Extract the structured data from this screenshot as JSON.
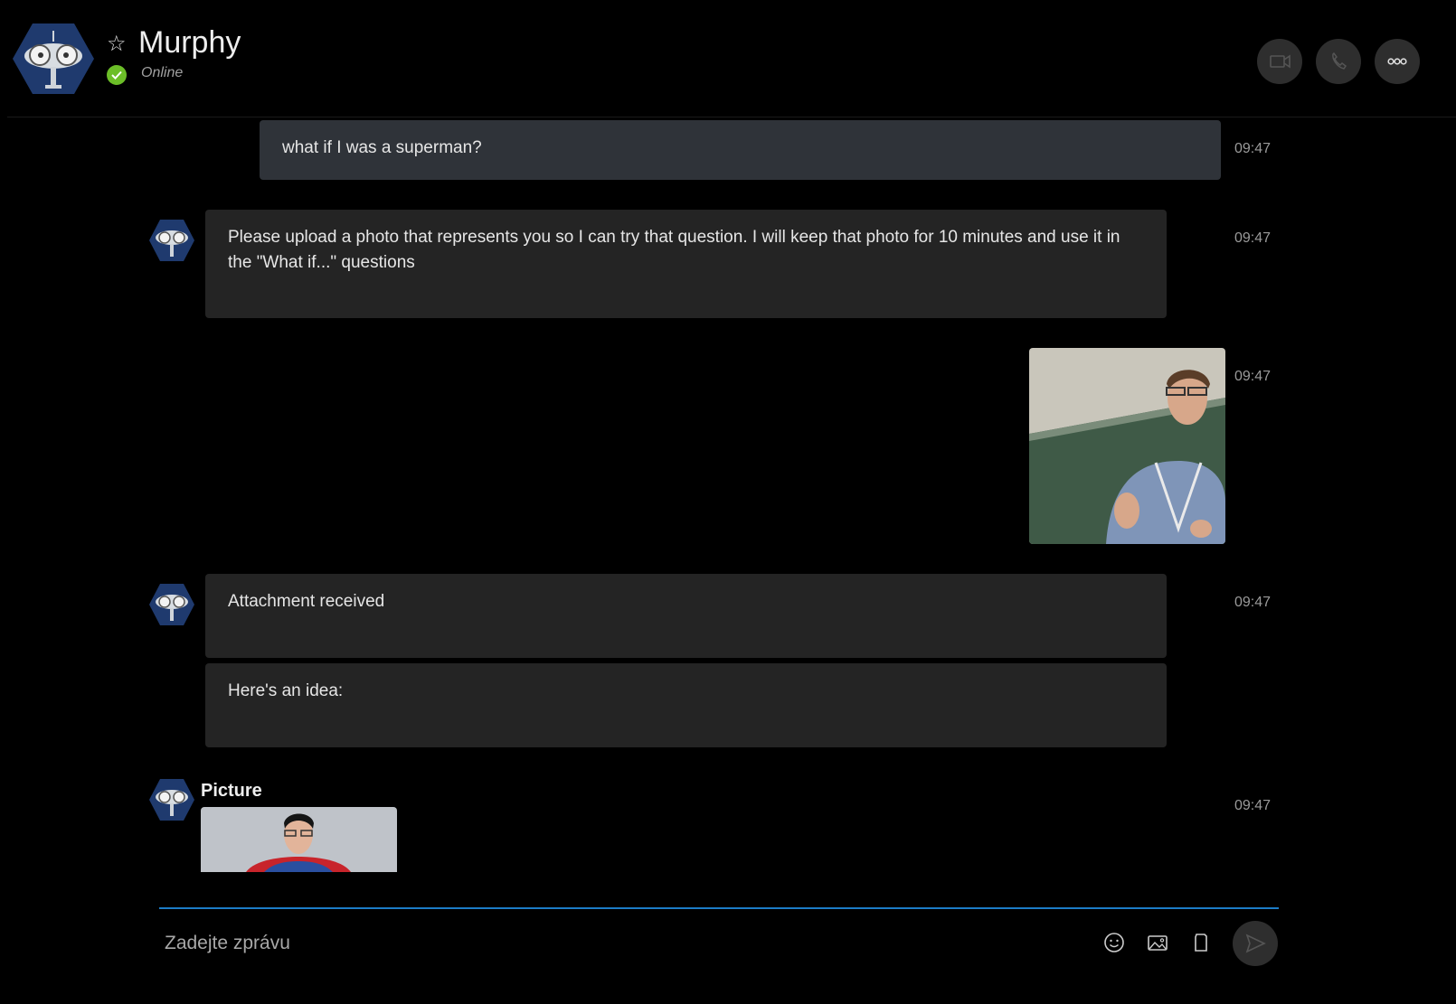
{
  "header": {
    "contact_name": "Murphy",
    "status": "Online",
    "status_color": "#6cbe28",
    "icons": [
      "star-icon",
      "video-call-icon",
      "phone-icon",
      "more-icon"
    ]
  },
  "messages": [
    {
      "direction": "outgoing",
      "type": "text",
      "text": "what if I was a superman?",
      "time": "09:47"
    },
    {
      "direction": "incoming",
      "type": "text",
      "text": "Please upload a photo that represents you so I can try that question. I will keep that photo for 10 minutes and use it in the \"What if...\" questions",
      "time": "09:47"
    },
    {
      "direction": "outgoing",
      "type": "image",
      "time": "09:47"
    },
    {
      "direction": "incoming",
      "type": "text",
      "text": "Attachment received",
      "time": "09:47"
    },
    {
      "direction": "incoming",
      "type": "text",
      "text": "Here's an idea:",
      "time": ""
    },
    {
      "direction": "incoming",
      "type": "image",
      "label": "Picture",
      "time": "09:47"
    }
  ],
  "composer": {
    "placeholder": "Zadejte zprávu",
    "value": "",
    "icons": [
      "emoji-icon",
      "image-attach-icon",
      "file-attach-icon",
      "send-icon"
    ],
    "accent_color": "#1c7cc7"
  }
}
